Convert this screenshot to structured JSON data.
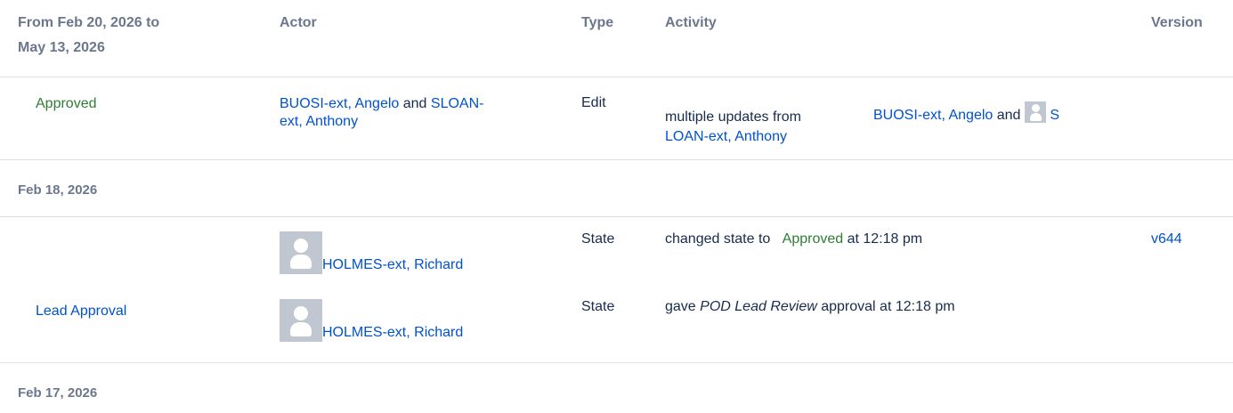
{
  "header": {
    "range_line1": "From Feb 20, 2026 to",
    "range_line2": "May 13, 2026",
    "actor": "Actor",
    "type": "Type",
    "activity": "Activity",
    "version": "Version"
  },
  "row1": {
    "status": "Approved",
    "actor1": "BUOSI-ext, Angelo",
    "and": "and",
    "actor2_part1": "SLOAN-",
    "actor2_part2": "ext, Anthony",
    "type": "Edit",
    "activity_prefix": "multiple updates from",
    "activity_actor1": "BUOSI-ext, Angelo",
    "activity_and": "and",
    "activity_actor2_part1": "S",
    "activity_actor2_part2": "LOAN-ext, Anthony"
  },
  "group2": {
    "date": "Feb 18, 2026"
  },
  "row2": {
    "actor": "HOLMES-ext, Richard",
    "type": "State",
    "activity_prefix": "changed state to",
    "activity_state": "Approved",
    "activity_suffix": "at 12:18 pm",
    "version": "v644"
  },
  "row3": {
    "status": "Lead Approval",
    "actor": "HOLMES-ext, Richard",
    "type": "State",
    "activity_prefix": "gave",
    "activity_review": "POD Lead Review",
    "activity_suffix": "approval at 12:18 pm"
  },
  "group3": {
    "date": "Feb 17, 2026"
  },
  "icons": {
    "avatar": "user-avatar-icon"
  },
  "colors": {
    "link": "#0052cc",
    "approved": "#2e7d32",
    "header": "#6b778c",
    "divider": "#dfe1e6"
  }
}
